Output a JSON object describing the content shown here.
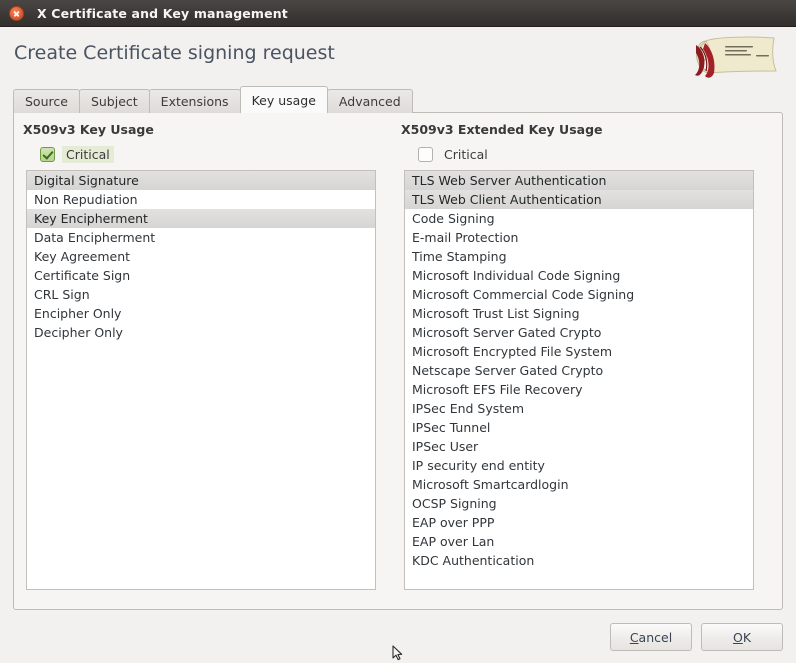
{
  "window": {
    "title": "X Certificate and Key management",
    "close_icon": "close-icon"
  },
  "dialog": {
    "heading": "Create Certificate signing request",
    "logo_icon": "certificate-scroll-logo"
  },
  "tabs": [
    {
      "label": "Source",
      "active": false
    },
    {
      "label": "Subject",
      "active": false
    },
    {
      "label": "Extensions",
      "active": false
    },
    {
      "label": "Key usage",
      "active": true
    },
    {
      "label": "Advanced",
      "active": false
    }
  ],
  "key_usage": {
    "title": "X509v3 Key Usage",
    "critical": {
      "label": "Critical",
      "checked": true,
      "focused": true
    },
    "items": [
      {
        "label": "Digital Signature",
        "selected": true
      },
      {
        "label": "Non Repudiation",
        "selected": false
      },
      {
        "label": "Key Encipherment",
        "selected": true
      },
      {
        "label": "Data Encipherment",
        "selected": false
      },
      {
        "label": "Key Agreement",
        "selected": false
      },
      {
        "label": "Certificate Sign",
        "selected": false
      },
      {
        "label": "CRL Sign",
        "selected": false
      },
      {
        "label": "Encipher Only",
        "selected": false
      },
      {
        "label": "Decipher Only",
        "selected": false
      }
    ]
  },
  "extended_key_usage": {
    "title": "X509v3 Extended Key Usage",
    "critical": {
      "label": "Critical",
      "checked": false,
      "focused": false
    },
    "items": [
      {
        "label": "TLS Web Server Authentication",
        "selected": true
      },
      {
        "label": "TLS Web Client Authentication",
        "selected": true
      },
      {
        "label": "Code Signing",
        "selected": false
      },
      {
        "label": "E-mail Protection",
        "selected": false
      },
      {
        "label": "Time Stamping",
        "selected": false
      },
      {
        "label": "Microsoft Individual Code Signing",
        "selected": false
      },
      {
        "label": "Microsoft Commercial Code Signing",
        "selected": false
      },
      {
        "label": "Microsoft Trust List Signing",
        "selected": false
      },
      {
        "label": "Microsoft Server Gated Crypto",
        "selected": false
      },
      {
        "label": "Microsoft Encrypted File System",
        "selected": false
      },
      {
        "label": "Netscape Server Gated Crypto",
        "selected": false
      },
      {
        "label": "Microsoft EFS File Recovery",
        "selected": false
      },
      {
        "label": "IPSec End System",
        "selected": false
      },
      {
        "label": "IPSec Tunnel",
        "selected": false
      },
      {
        "label": "IPSec User",
        "selected": false
      },
      {
        "label": "IP security end entity",
        "selected": false
      },
      {
        "label": "Microsoft Smartcardlogin",
        "selected": false
      },
      {
        "label": "OCSP Signing",
        "selected": false
      },
      {
        "label": "EAP over PPP",
        "selected": false
      },
      {
        "label": "EAP over Lan",
        "selected": false
      },
      {
        "label": "KDC Authentication",
        "selected": false
      }
    ]
  },
  "buttons": {
    "cancel": {
      "mnemonic": "C",
      "rest": "ancel"
    },
    "ok": {
      "mnemonic": "O",
      "rest": "K"
    }
  },
  "colors": {
    "window_bg": "#f2f1f0",
    "titlebar": "#3b3735",
    "panel_bg": "#f6f5f4",
    "list_bg": "#ffffff",
    "selection": "#dcdbd9",
    "heading_text": "#4a5360",
    "accent_green": "#6f9c3f",
    "close_button": "#e2653b"
  }
}
